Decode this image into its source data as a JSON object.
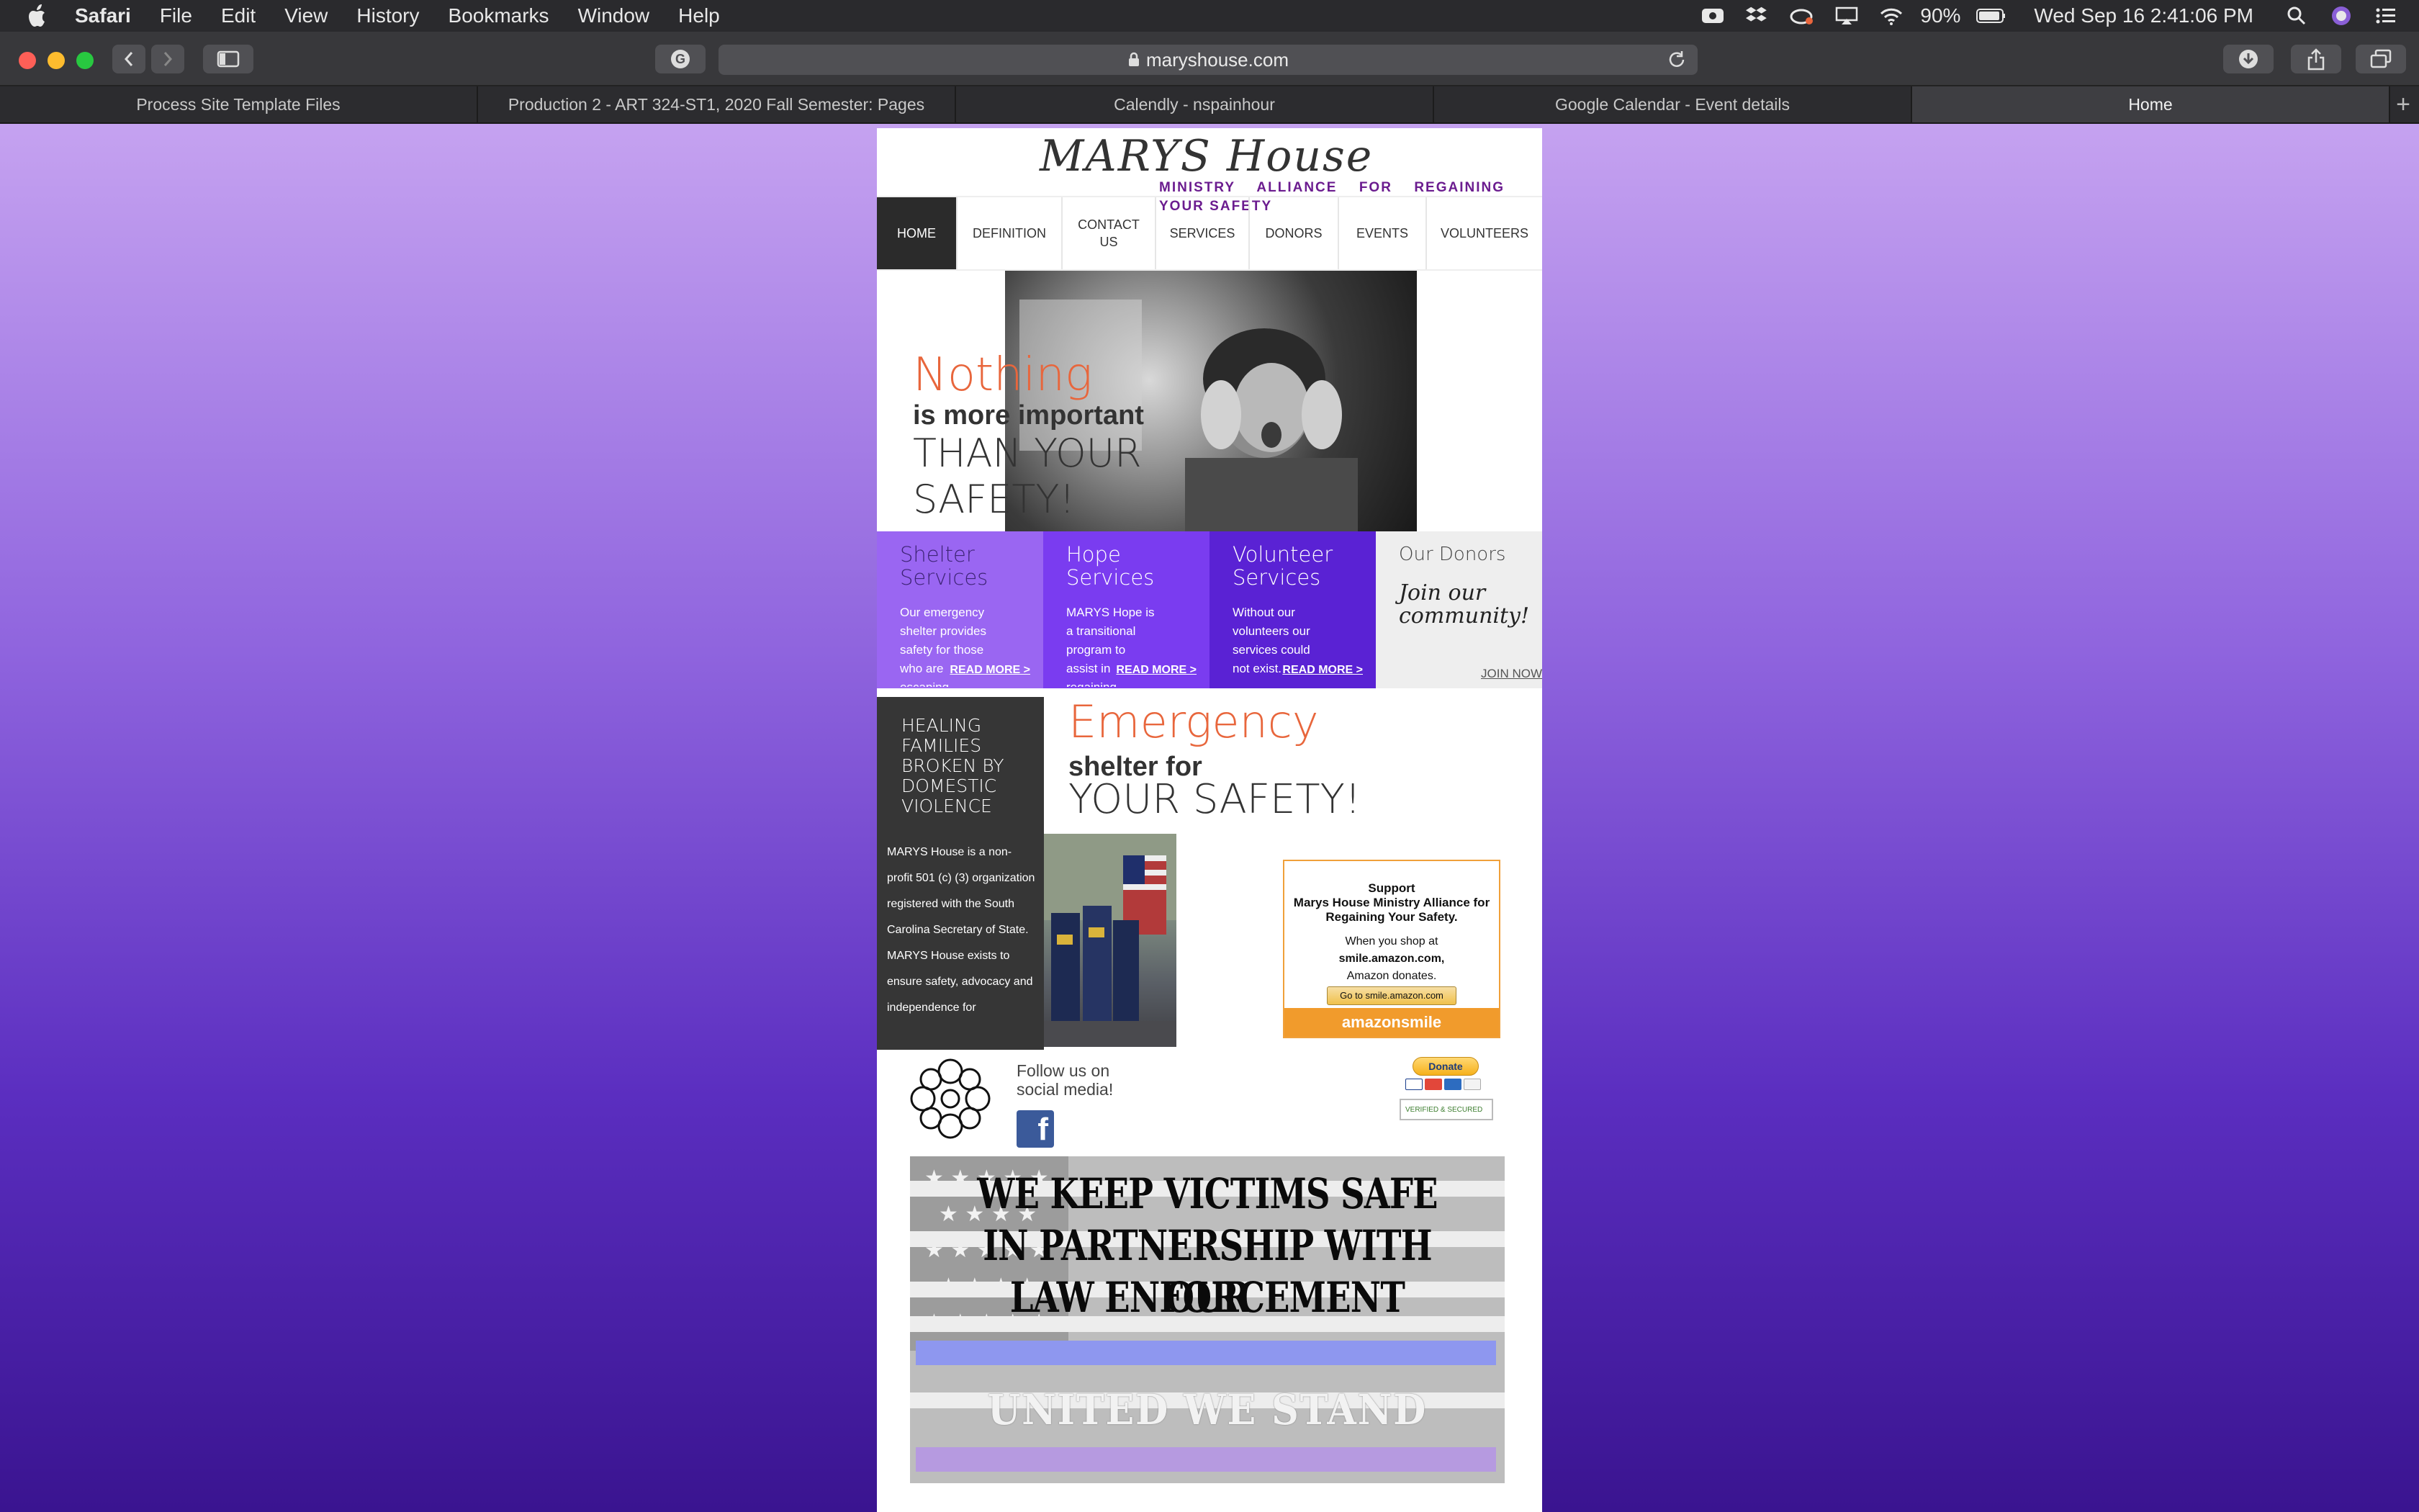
{
  "menubar": {
    "app_name": "Safari",
    "menus": [
      "File",
      "Edit",
      "View",
      "History",
      "Bookmarks",
      "Window",
      "Help"
    ],
    "battery": "90%",
    "datetime": "Wed Sep 16  2:41:06 PM"
  },
  "browser": {
    "url": "maryshouse.com",
    "tabs": [
      "Process Site Template Files",
      "Production 2 - ART 324-ST1, 2020 Fall Semester: Pages",
      "Calendly - nspainhour",
      "Google Calendar - Event details",
      "Home"
    ],
    "active_tab": 4
  },
  "site": {
    "logo": "MARYS House",
    "tagline": "MINISTRY ALLIANCE FOR REGAINING YOUR SAFETY",
    "nav": [
      "HOME",
      "DEFINITION",
      "CONTACT US",
      "SERVICES",
      "DONORS",
      "EVENTS",
      "VOLUNTEERS"
    ],
    "hero": {
      "line1": "Nothing",
      "line2": "is more important",
      "line3a": "THAN YOUR",
      "line3b": "SAFETY!"
    },
    "boxes": [
      {
        "title": "Shelter Services",
        "text": "Our emergency shelter provides safety for those who are escaping dangerous",
        "more": "READ MORE >"
      },
      {
        "title": "Hope Services",
        "text": "MARYS Hope is a transitional program to assist in regaining independence",
        "more": "READ MORE >"
      },
      {
        "title": "Volunteer Services",
        "text": "Without our volunteers our services could not exist.",
        "more": "READ MORE >"
      }
    ],
    "donors": {
      "title": "Our Donors",
      "script": "Join our community!",
      "join": "JOIN NOW"
    },
    "healing": {
      "title": "HEALING FAMILIES BROKEN BY DOMESTIC VIOLENCE",
      "text": "MARYS House is a non-profit 501 (c) (3) organization registered with the South Carolina Secretary of State. MARYS House exists to ensure safety, advocacy and independence for"
    },
    "emergency": {
      "line1": "Emergency",
      "line2": "shelter for",
      "line3": "YOUR SAFETY!"
    },
    "amazon": {
      "support": "Support",
      "org": "Marys House Ministry Alliance for Regaining Your Safety.",
      "shop1": "When you shop at",
      "shop2": "smile.amazon.com,",
      "shop3": "Amazon donates.",
      "button": "Go to smile.amazon.com",
      "brand": "amazonsmile"
    },
    "social": {
      "follow": "Follow us on social media!",
      "fb": "f"
    },
    "donate": {
      "button": "Donate",
      "secure": "VERIFIED & SECURED"
    },
    "banner": {
      "line1": "WE KEEP VICTIMS SAFE",
      "line2": "IN PARTNERSHIP WITH OUR",
      "line3": "LAW ENFORCEMENT",
      "line4": "UNITED WE STAND"
    }
  }
}
